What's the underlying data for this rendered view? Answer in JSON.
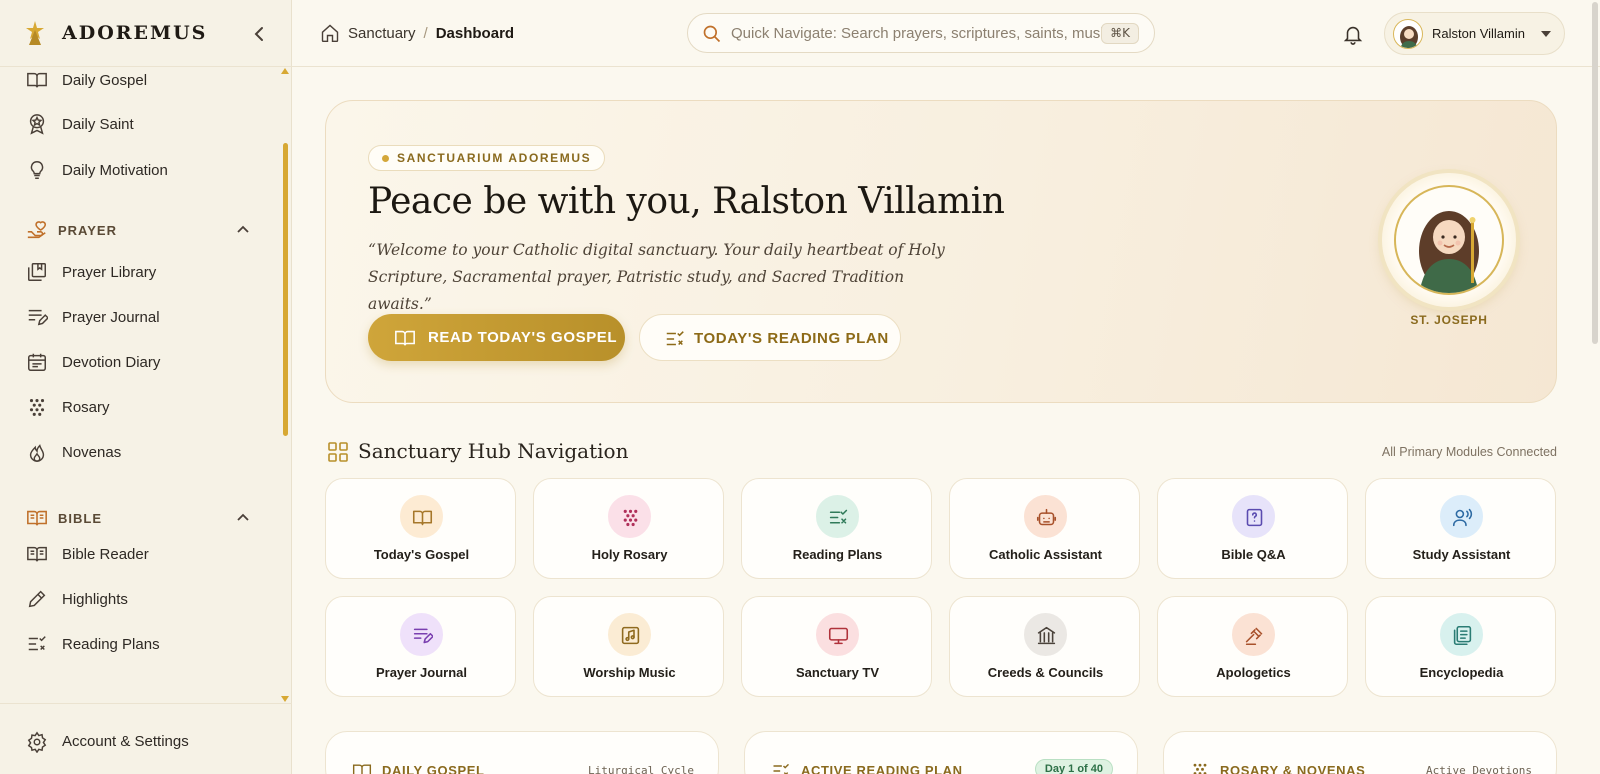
{
  "brand": {
    "name": "ADOREMUS"
  },
  "sidebar": {
    "items_top": [
      {
        "label": "Daily Gospel",
        "icon": "book-open-icon"
      },
      {
        "label": "Daily Saint",
        "icon": "saint-badge-icon"
      },
      {
        "label": "Daily Motivation",
        "icon": "lightbulb-icon"
      }
    ],
    "prayer": {
      "title": "PRAYER",
      "items": [
        {
          "label": "Prayer Library",
          "icon": "library-icon"
        },
        {
          "label": "Prayer Journal",
          "icon": "journal-pen-icon"
        },
        {
          "label": "Devotion Diary",
          "icon": "calendar-icon"
        },
        {
          "label": "Rosary",
          "icon": "rosary-dots-icon"
        },
        {
          "label": "Novenas",
          "icon": "flame-icon"
        }
      ]
    },
    "bible": {
      "title": "BIBLE",
      "items": [
        {
          "label": "Bible Reader",
          "icon": "bible-icon"
        },
        {
          "label": "Highlights",
          "icon": "pen-icon"
        },
        {
          "label": "Reading Plans",
          "icon": "list-check-icon"
        }
      ]
    },
    "account_label": "Account & Settings"
  },
  "topbar": {
    "breadcrumb": [
      "Sanctuary",
      "/",
      "Dashboard"
    ],
    "search_placeholder": "Quick Navigate: Search prayers, scriptures, saints, music, to",
    "search_shortcut": "⌘K",
    "user_name": "Ralston Villamin"
  },
  "hero": {
    "pill": "SANCTUARIUM ADOREMUS",
    "greeting": "Peace be with you, Ralston Villamin",
    "quote": "“Welcome to your Catholic digital sanctuary. Your daily heartbeat of Holy Scripture, Sacramental prayer, Patristic study, and Sacred Tradition awaits.”",
    "primary_button": "READ TODAY'S GOSPEL",
    "secondary_button": "TODAY'S READING PLAN",
    "saint_name": "ST. JOSEPH"
  },
  "hub": {
    "title": "Sanctuary Hub Navigation",
    "status": "All Primary Modules Connected",
    "tiles": [
      {
        "label": "Today's Gospel",
        "icon": "book-open-icon",
        "bg": "#fdebd3",
        "fg": "#a6772a"
      },
      {
        "label": "Holy Rosary",
        "icon": "rosary-dots-icon",
        "bg": "#fbe0e8",
        "fg": "#b0305a"
      },
      {
        "label": "Reading Plans",
        "icon": "list-check-icon",
        "bg": "#dcf1e7",
        "fg": "#2f7a59"
      },
      {
        "label": "Catholic Assistant",
        "icon": "robot-icon",
        "bg": "#fbe2d4",
        "fg": "#a8512b"
      },
      {
        "label": "Bible Q&A",
        "icon": "question-book-icon",
        "bg": "#e7e3fa",
        "fg": "#5a4bb0"
      },
      {
        "label": "Study Assistant",
        "icon": "speaking-person-icon",
        "bg": "#dcedfa",
        "fg": "#2d6aa3"
      },
      {
        "label": "Prayer Journal",
        "icon": "journal-pen-icon",
        "bg": "#efe1fa",
        "fg": "#7a3fb0"
      },
      {
        "label": "Worship Music",
        "icon": "music-note-icon",
        "bg": "#fbecd4",
        "fg": "#8f6a1f"
      },
      {
        "label": "Sanctuary TV",
        "icon": "monitor-icon",
        "bg": "#fbdfe0",
        "fg": "#b0323b"
      },
      {
        "label": "Creeds & Councils",
        "icon": "columns-icon",
        "bg": "#ebe8e4",
        "fg": "#4a423a"
      },
      {
        "label": "Apologetics",
        "icon": "gavel-icon",
        "bg": "#fbe2d4",
        "fg": "#a8512b"
      },
      {
        "label": "Encyclopedia",
        "icon": "pages-icon",
        "bg": "#d8f1ee",
        "fg": "#2a7c74"
      }
    ]
  },
  "cards": [
    {
      "title": "DAILY GOSPEL",
      "meta": "Liturgical Cycle",
      "icon": "book-open-icon"
    },
    {
      "title": "ACTIVE READING PLAN",
      "badge": "Day 1 of 40",
      "icon": "list-check-icon"
    },
    {
      "title": "ROSARY & NOVENAS",
      "meta": "Active Devotions",
      "icon": "rosary-dots-icon"
    }
  ],
  "colors": {
    "accent": "#c69c34",
    "background": "#fbf8ef",
    "sidebar": "#f6f2e6"
  }
}
